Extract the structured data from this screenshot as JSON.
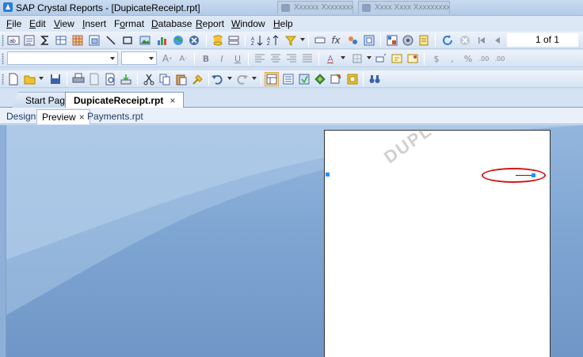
{
  "window": {
    "title": "SAP Crystal Reports - [DupicateReceipt.rpt]",
    "background_windows": [
      "Xxxxxx Xxxxxxxx Xx",
      "Xxxx Xxxx Xxxxxxxxx Xx"
    ]
  },
  "menu": {
    "items": [
      {
        "label": "File",
        "ul": "F",
        "rest": "ile"
      },
      {
        "label": "Edit",
        "ul": "E",
        "rest": "dit"
      },
      {
        "label": "View",
        "ul": "V",
        "rest": "iew"
      },
      {
        "label": "Insert",
        "ul": "I",
        "rest": "nsert"
      },
      {
        "label": "Format",
        "ul": "o",
        "pre": "F",
        "rest": "rmat"
      },
      {
        "label": "Database",
        "ul": "D",
        "rest": "atabase"
      },
      {
        "label": "Report",
        "ul": "R",
        "rest": "eport"
      },
      {
        "label": "Window",
        "ul": "W",
        "rest": "indow"
      },
      {
        "label": "Help",
        "ul": "H",
        "rest": "elp"
      }
    ]
  },
  "toolbar_nav": {
    "page_indicator": "1 of 1"
  },
  "format_toolbar": {
    "font_name": "",
    "font_size": "",
    "currency_symbol": "$",
    "thousands_symbol": ",",
    "percent_symbol": "%",
    "decimal_more": ".00",
    "bold": "B",
    "italic": "I",
    "underline": "U",
    "font_color_letter": "A"
  },
  "document_tabs": [
    {
      "label": "Start Page",
      "active": false
    },
    {
      "label": "DupicateReceipt.rpt",
      "active": true,
      "close": "×"
    }
  ],
  "view_tabs": [
    {
      "label": "Design",
      "active": false
    },
    {
      "label": "Preview",
      "active": true,
      "close": "×"
    },
    {
      "label": "Payments.rpt",
      "active": false
    }
  ],
  "preview": {
    "watermark_text": "DUPL"
  },
  "colors": {
    "callout": "#d01818",
    "selection_handle": "#1e90ff",
    "preview_bg": "#7fa6d3"
  }
}
